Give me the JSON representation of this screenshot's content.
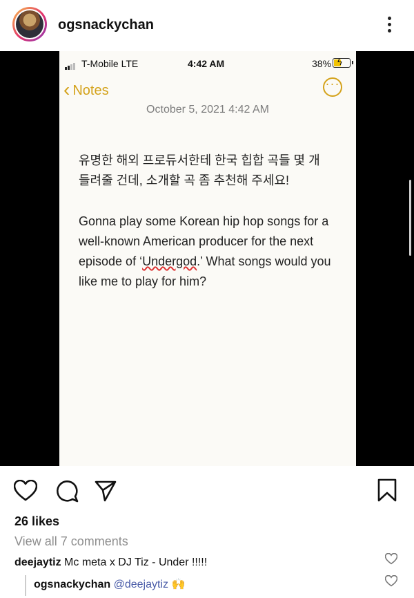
{
  "post": {
    "username": "ogsnackychan"
  },
  "phone": {
    "carrier": "T-Mobile  LTE",
    "time": "4:42 AM",
    "battery": "38%",
    "back_label": "Notes",
    "date": "October 5, 2021 4:42 AM",
    "korean_text": "유명한 해외 프로듀서한테 한국 힙합 곡들 몇 개 들려줄 건데, 소개할 곡 좀 추천해 주세요!",
    "english_before": "Gonna play some Korean hip hop songs for a well-known American producer for the next episode of ‘",
    "english_highlight": "Undergod",
    "english_after": ".’  What songs would you like me to play for him?"
  },
  "engagement": {
    "likes": "26 likes",
    "view_comments": "View all 7 comments"
  },
  "comments": [
    {
      "user": "deejaytiz",
      "text": "Mc meta x DJ Tiz - Under !!!!!"
    },
    {
      "user": "ogsnackychan",
      "mention": "@deejaytiz",
      "emoji": "🙌"
    }
  ],
  "icons": [
    "heart-icon",
    "comment-icon",
    "share-icon",
    "bookmark-icon",
    "more-icon"
  ],
  "colors": {
    "notes_accent": "#d4a21a",
    "mention": "#4a5ca8",
    "muted": "#8e8e8e"
  }
}
